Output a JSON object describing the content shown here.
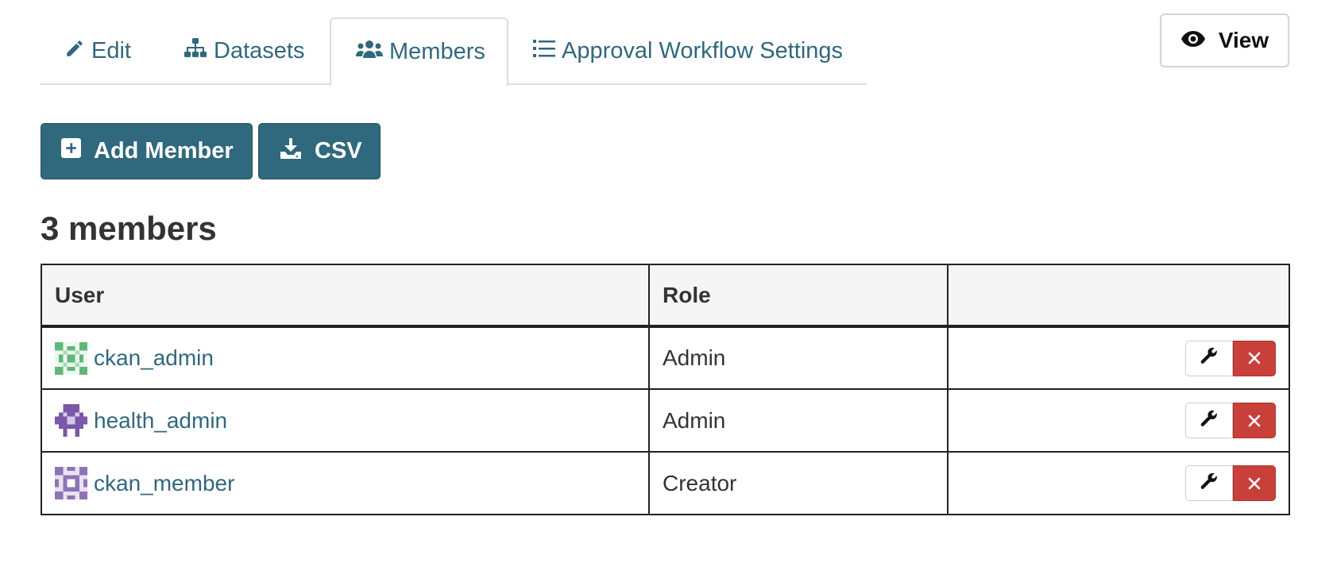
{
  "tabs": [
    {
      "label": "Edit",
      "icon": "pencil-icon"
    },
    {
      "label": "Datasets",
      "icon": "sitemap-icon"
    },
    {
      "label": "Members",
      "icon": "users-icon",
      "active": true
    },
    {
      "label": "Approval Workflow Settings",
      "icon": "list-icon"
    }
  ],
  "view_button": {
    "label": "View",
    "icon": "eye-icon"
  },
  "actions": {
    "add_member": {
      "label": "Add Member",
      "icon": "plus-square-icon"
    },
    "csv": {
      "label": "CSV",
      "icon": "download-icon"
    }
  },
  "heading": "3 members",
  "table": {
    "columns": [
      "User",
      "Role",
      ""
    ],
    "rows": [
      {
        "user": "ckan_admin",
        "role": "Admin",
        "avatar_color": "#5fb87a"
      },
      {
        "user": "health_admin",
        "role": "Admin",
        "avatar_color": "#7b58a8"
      },
      {
        "user": "ckan_member",
        "role": "Creator",
        "avatar_color": "#8e73b6"
      }
    ]
  },
  "colors": {
    "accent": "#30687d",
    "danger": "#c9403b",
    "header_bg": "#f5f5f5"
  }
}
